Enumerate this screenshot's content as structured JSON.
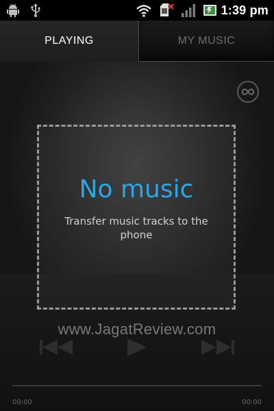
{
  "status_bar": {
    "time": "1:39 pm",
    "icons": [
      "android-debug-icon",
      "usb-icon",
      "wifi-icon",
      "sim-card-error-icon",
      "signal-icon",
      "battery-icon"
    ]
  },
  "tabs": [
    {
      "label": "PLAYING",
      "active": true
    },
    {
      "label": "MY MUSIC",
      "active": false
    }
  ],
  "player": {
    "empty_title": "No music",
    "empty_message": "Transfer music tracks to the phone",
    "elapsed": "00:00",
    "total": "00:00",
    "progress": 0
  },
  "controls": [
    "previous-icon",
    "play-icon",
    "next-icon"
  ],
  "watermark": "www.JagatReview.com",
  "colors": {
    "accent": "#2ba6e6",
    "background": "#1a1a1a",
    "tab_active_text": "#ffffff",
    "tab_inactive_text": "#6e6e6e"
  }
}
